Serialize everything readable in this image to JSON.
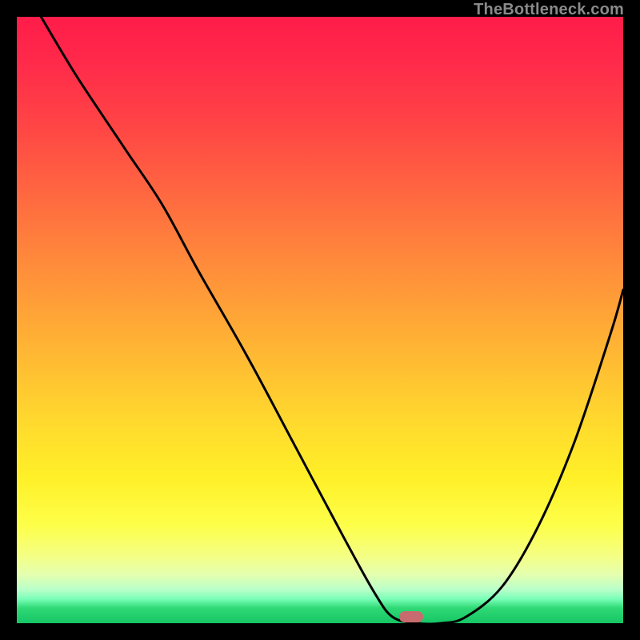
{
  "watermark": "TheBottleneck.com",
  "marker": {
    "x_pct": 65.0,
    "y_pct": 99.0
  },
  "chart_data": {
    "type": "line",
    "title": "",
    "xlabel": "",
    "ylabel": "",
    "xlim": [
      0,
      100
    ],
    "ylim": [
      0,
      100
    ],
    "grid": false,
    "legend": false,
    "series": [
      {
        "name": "curve",
        "x": [
          4,
          10,
          18,
          24,
          30,
          38,
          46,
          54,
          59,
          62,
          66,
          70,
          74,
          80,
          86,
          92,
          98,
          100
        ],
        "y": [
          0,
          10,
          22,
          31,
          42,
          56,
          71,
          86,
          95,
          99,
          100,
          100,
          99,
          94,
          84,
          70,
          52,
          45
        ]
      }
    ],
    "annotations": [
      {
        "type": "marker-pill",
        "x": 65,
        "y": 99,
        "color": "#c86b6e"
      }
    ],
    "background_gradient_stops": [
      {
        "pct": 0,
        "color": "#ff1c4a"
      },
      {
        "pct": 18,
        "color": "#ff4545"
      },
      {
        "pct": 42,
        "color": "#ff8f3a"
      },
      {
        "pct": 66,
        "color": "#ffd72e"
      },
      {
        "pct": 84,
        "color": "#fdff4a"
      },
      {
        "pct": 94,
        "color": "#b8ffca"
      },
      {
        "pct": 100,
        "color": "#16c565"
      }
    ]
  }
}
